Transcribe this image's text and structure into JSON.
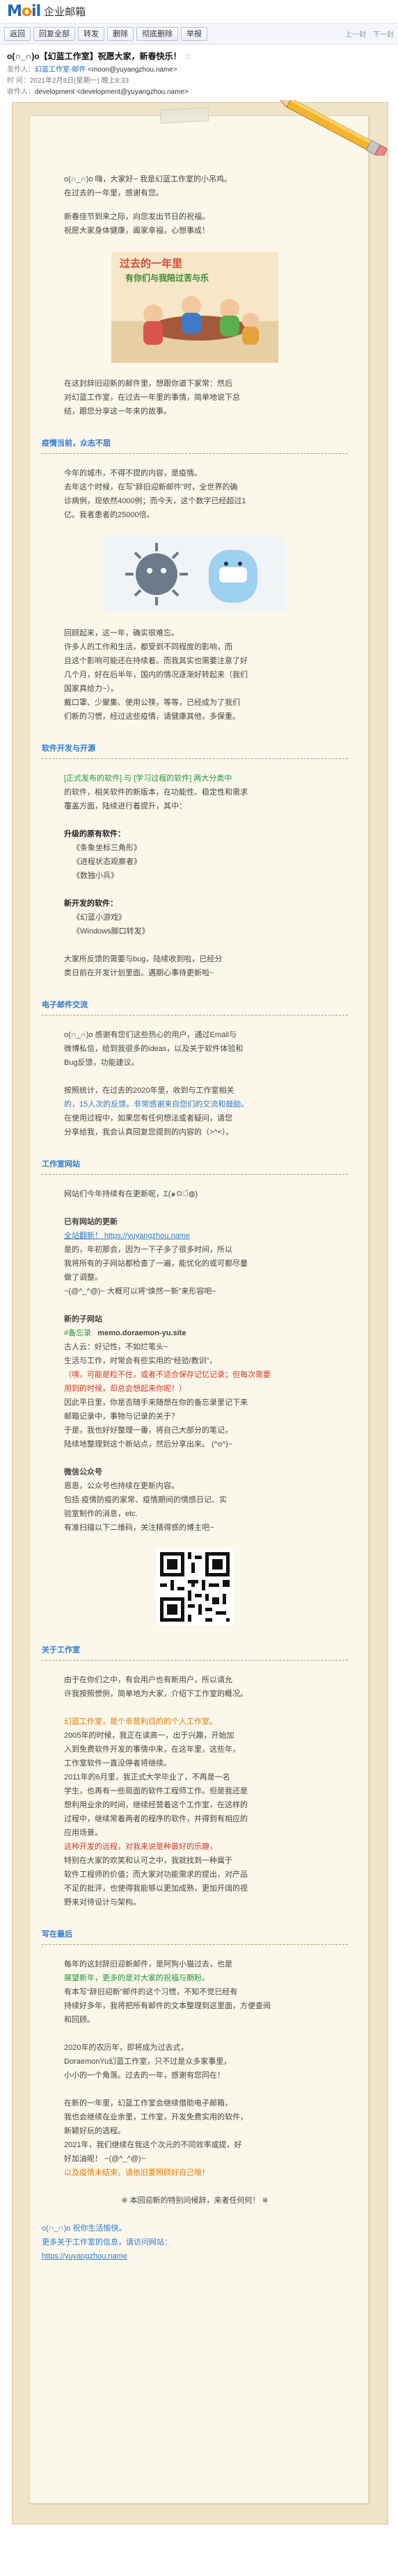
{
  "brand": {
    "mark": "Mail",
    "text": "企业邮箱"
  },
  "toolbar": {
    "buttons": [
      "返回",
      "回复全部",
      "转发",
      "删除",
      "彻底删除",
      "举报"
    ],
    "right": [
      "上一封",
      "下一封"
    ]
  },
  "header": {
    "subject": "o(∩_∩)o【幻蓝工作室】祝愿大家，新春快乐！",
    "from_label": "发件人：",
    "from_name": "幻蓝工作室-邮件",
    "from_addr": "<moon@yuyangzhou.name>",
    "time_label": "时 间：",
    "time": "2021年2月8日(星期一) 晚上8:33",
    "to_label": "收件人：",
    "to": "development <development@yuyangzhou.name>"
  },
  "body": {
    "greeting": "o(∩_∩)o 嗨，大家好~ 我是幻蓝工作室的小吊鸡。",
    "intro1": "在过去的一年里，感谢有您。",
    "intro2": "新春佳节到来之际，向您发出节日的祝福。",
    "intro3": "祝愿大家身体健康，阖家幸福，心想事成！",
    "image1_title": "过去的一年里",
    "image1_subtitle": "有你们与我陪过苦与乐",
    "p_after_image": [
      "在这封辞旧迎新的邮件里，想跟你道下家常：然后",
      "对幻蓝工作室，在过去一年里的事情，简单地说下总",
      "结，跟您分享这一年来的故事。"
    ],
    "sec1": "疫情当前，众志不屈",
    "sec1_p1": [
      "今年的城市，不得不提的内容，是疫情。",
      "去年这个时候，在写“辞旧迎新邮件”时，全世界的确",
      "诊病例，现依然4000例；而今天，这个数字已经超过1",
      "亿。我者患者的25000倍。"
    ],
    "sec1_p2": [
      "回顾起来，这一年，确实很难忘。",
      "许多人的工作和生活，都受到不同程度的影响，而",
      "且这个影响可能还在持续着。而我其实也需要注意了好",
      "几个月，好在后半年，国内的情况逐渐好转起来（我们",
      "国家真给力~）。",
      "戴口罩、少聚集、使用公筷，等等，已经成为了我们",
      "们新的习惯，经过这些疫情，请健康其他，多保重。"
    ],
    "sec2": "软件开发与开源",
    "sec2_p1": [
      "[正式发布的软件] 与 [学习过程的软件] 两大分类中",
      "的软件，相关软件的新版本，在功能性、稳定性和需求",
      "覆盖方面，陆续进行着提升，其中："
    ],
    "list_updated_title": "升级的原有软件：",
    "list_updated": [
      "《条象坐标三角形》",
      "《进程状态观察者》",
      "《数独小兵》"
    ],
    "list_new_title": "新开发的软件：",
    "list_new": [
      "《幻蓝小游戏》",
      "《Windows脚口转发》"
    ],
    "sec2_p2": [
      "大家所反馈的需要与bug，陆续收到啦，已经分",
      "类日前在开发计划里面。遇期心事待更新啦~"
    ],
    "sec3": "电子邮件交流",
    "sec3_p1": [
      "o(∩_∩)o 感谢有您们这些热心的用户，通过Email与",
      "微博私信，给到我很多的ideas，以及关于软件体验和",
      "Bug反馈，功能建议。"
    ],
    "sec3_p2": [
      "按照统计，在过去的2020年里，收到与工作室相关",
      "的，15人次的反馈。非常感谢来自您们的交流和鼓励。",
      "在使用过程中，如果您有任何想法或者疑问，请您",
      "分享给我，我会认真回复您提到的内容的（>^<）。"
    ],
    "sec4": "工作室网站",
    "sec4_p1": "网站们今年持续有在更新呢，Σ(๑ㅁ๑̀◍)",
    "web_title": "已有网站的更新",
    "web_site": "全站翻新！ https://yuyangzhou.name",
    "web_p": [
      "是的，年初那会，因为一下子多了很多时间，所以",
      "我将所有的子网站都检查了一遍，能优化的或可都尽量",
      "做了调整。",
      "~(@^_^@)~ 大概可以将“焕然一新”来形容吧~"
    ],
    "new_site_title": "新的子网站",
    "new_site_tag": "#备忘录",
    "new_site_url": "memo.doraemon-yu.site",
    "new_site_p": [
      "古人云：好记性，不如烂笔头~",
      "生活与工作，时常会有些实用的“经验/教训”，",
      "（咦，可能是粒不住，或者不适合保存记忆记录；但每次需要",
      "用到的时候，却总会想起来你呢！）",
      "因此平日里，你是否随手来随想在你的备忘录里记下来",
      "邮箱记录中，事物与记录的关于？",
      "于是，我也好好整理一番，将自己大部分的笔记，",
      "陆续地整理到这个新站点，然后分享出来。 (^o^)~"
    ],
    "wechat_title": "微信公众号",
    "wechat_p": [
      "恩恩，公众号也持续在更新内容。",
      "包括 疫情防疫的家常、疫情期间的情感日记、实",
      "验室制作的消息，etc.",
      "有准扫描以下二维码，关注精得感的博主吧~"
    ],
    "sec5": "关于工作室",
    "sec5_p1": [
      "由于在你们之中，有会用户也有新用户，所以请允",
      "许我按照惯例，简单地为大家，介绍下工作室的概况。"
    ],
    "sec5_p2": [
      "幻蓝工作室，是个非营利目的的个人工作室。",
      "2005年的时候，我正在读高一，出于兴趣，开始加",
      "入到免费软件开发的事情中来，在这年里，这些年，",
      "工作室软件一直没停者将继续。",
      "2011年的6月里，我正式大学毕业了，不再是一名",
      "学生，也再有一些局面的软件工程师工作。但是我还是",
      "想利用业余的时间，继续经营着这个工作室，在这样的",
      "过程中，继续常着两者的程序的软件，并得到有相应的",
      "应用场景。",
      "这种开发的远程，对我来说是种最好的乐趣，",
      "特别在大家的欢笑和认可之中，我就找到一种属于",
      "软件工程师的价值；而大家对功能需求的提出，对产品",
      "不足的批评，也使得我能够以更加成熟，更加开阔的视",
      "野来对待设计与架构。"
    ],
    "sec6": "写在最后",
    "sec6_p1": [
      "每年的这封辞旧迎新邮件，是阿狗小猫过去，也是",
      "展望新年，更多的是对大家的祝福与期盼。",
      "有本写“辞旧迎新”邮件的这个习惯，不知不觉已经有",
      "持续好多年，我将把所有邮件的文本整理到这里面，方便查阅",
      "和回顾。"
    ],
    "sec6_p2": [
      "2020年的农历年，即将成为过去式，",
      "DoraemonYu幻蓝工作室，只不过是众多家事里，",
      "小小的一个角落。过去的一年，感谢有您同在！"
    ],
    "sec6_p3": [
      "在新的一年里，幻蓝工作室会继续借助电子邮箱，",
      "我也会继续在业余里，工作室，开发免费实用的软件，",
      "新颖好玩的选程。",
      "2021年，我们继续在我这个次元的不同效率或提，好",
      "好加油呢！ ~(@^_^@)~",
      "以及疫情未结束，请依旧要照顾好自己哦！"
    ],
    "sec6_sign": "※ 本回迎新的特别问候辞，来者任何何！ ※",
    "footer_note1": "o(∩_∩)o 祝你生活愉快。",
    "footer_note2": "更多关于工作室的信息，请访问网站：",
    "footer_url": "https://yuyangzhou.name"
  }
}
